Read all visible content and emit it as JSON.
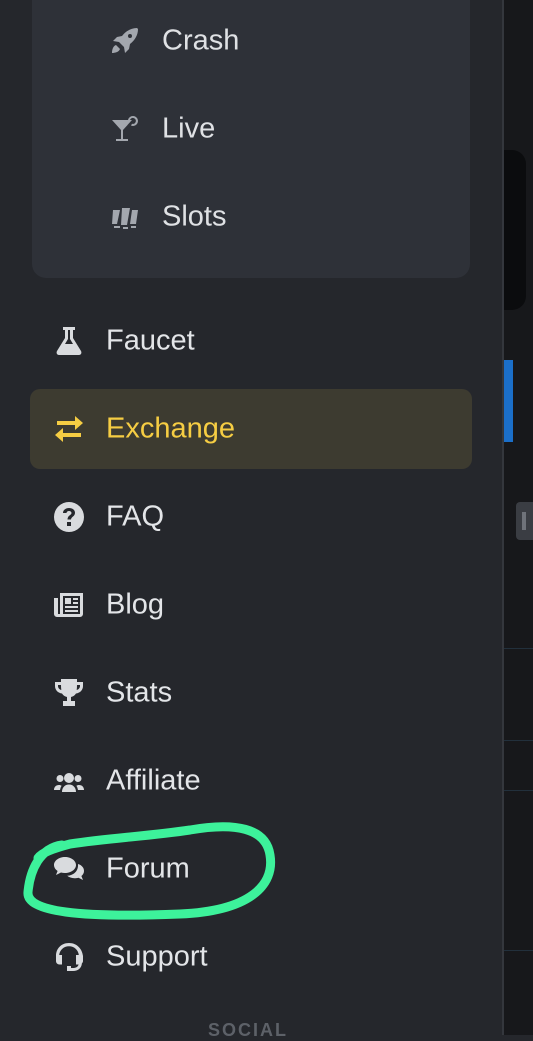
{
  "games": [
    {
      "label": "Crash",
      "icon": "rocket-icon"
    },
    {
      "label": "Live",
      "icon": "cocktail-icon"
    },
    {
      "label": "Slots",
      "icon": "slot-machine-icon"
    }
  ],
  "nav": [
    {
      "label": "Faucet",
      "icon": "flask-icon",
      "active": false
    },
    {
      "label": "Exchange",
      "icon": "exchange-arrows-icon",
      "active": true
    },
    {
      "label": "FAQ",
      "icon": "question-circle-icon",
      "active": false
    },
    {
      "label": "Blog",
      "icon": "newspaper-icon",
      "active": false
    },
    {
      "label": "Stats",
      "icon": "trophy-icon",
      "active": false
    },
    {
      "label": "Affiliate",
      "icon": "users-icon",
      "active": false
    },
    {
      "label": "Forum",
      "icon": "comments-icon",
      "active": false
    },
    {
      "label": "Support",
      "icon": "headset-icon",
      "active": false
    }
  ],
  "section": {
    "social": "SOCIAL"
  },
  "colors": {
    "accent": "#f6cd43",
    "annotation": "#3df29b",
    "background": "#25272c"
  }
}
